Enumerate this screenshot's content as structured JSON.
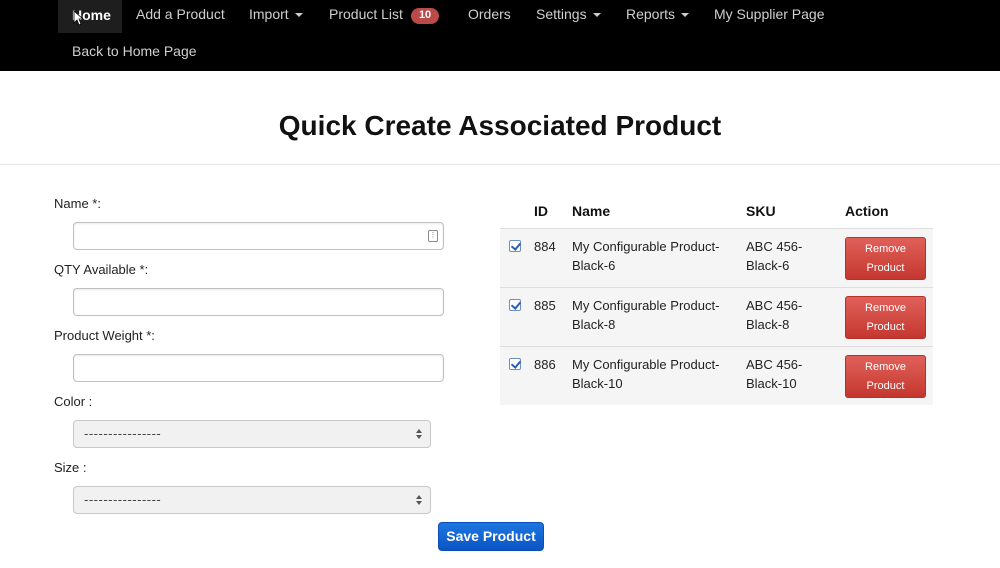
{
  "nav": {
    "items": [
      {
        "label": "Home"
      },
      {
        "label": "Add a Product"
      },
      {
        "label": "Import"
      },
      {
        "label": "Product List",
        "badge": "10"
      },
      {
        "label": "Orders"
      },
      {
        "label": "Settings"
      },
      {
        "label": "Reports"
      },
      {
        "label": "My Supplier Page"
      }
    ],
    "back_label": "Back to Home Page"
  },
  "page": {
    "title": "Quick Create Associated Product"
  },
  "form": {
    "name_label": "Name *:",
    "qty_label": "QTY Available *:",
    "weight_label": "Product Weight *:",
    "color_label": "Color :",
    "size_label": "Size :",
    "color_value": "----------------",
    "size_value": "----------------",
    "save_label": "Save Product"
  },
  "table": {
    "headers": [
      "ID",
      "Name",
      "SKU",
      "Action"
    ],
    "rows": [
      {
        "id": "884",
        "name1": "My Configurable Product-",
        "name2": "Black-6",
        "sku1": "ABC 456-",
        "sku2": "Black-6",
        "action1": "Remove",
        "action2": "Product"
      },
      {
        "id": "885",
        "name1": "My Configurable Product-",
        "name2": "Black-8",
        "sku1": "ABC 456-",
        "sku2": "Black-8",
        "action1": "Remove",
        "action2": "Product"
      },
      {
        "id": "886",
        "name1": "My Configurable Product-",
        "name2": "Black-10",
        "sku1": "ABC 456-",
        "sku2": "Black-10",
        "action1": "Remove",
        "action2": "Product"
      }
    ]
  },
  "colors": {
    "navbar": "#000000",
    "badge": "#b94a48",
    "save_button": "#0a55c4",
    "remove_button": "#d9534f"
  }
}
